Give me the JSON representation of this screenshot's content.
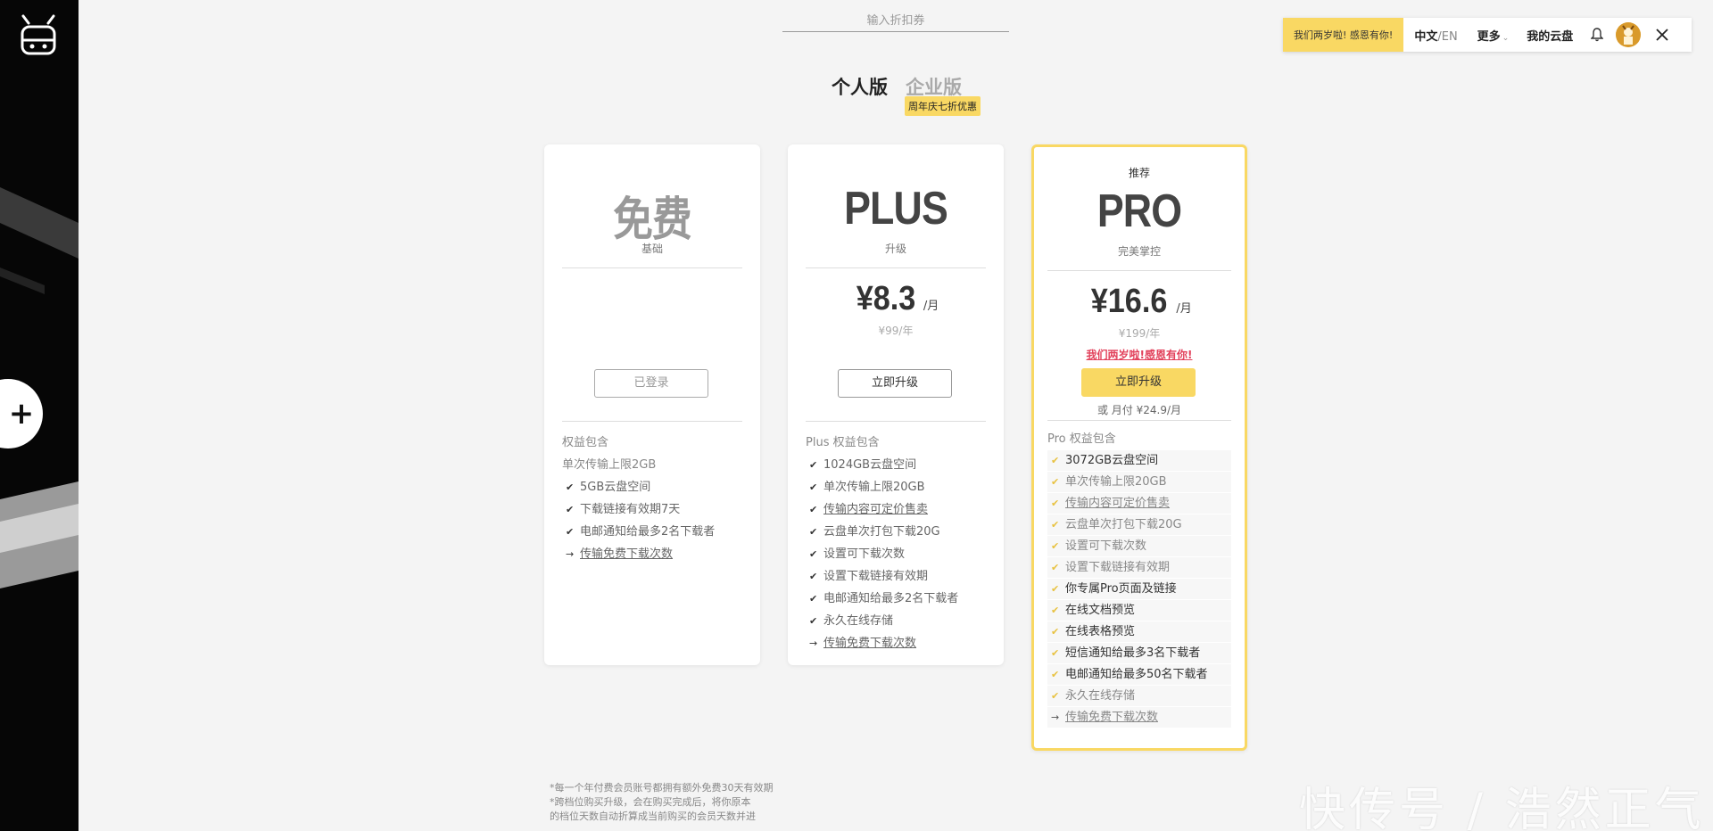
{
  "coupon": {
    "placeholder": "输入折扣券"
  },
  "topbar": {
    "promo": "我们两岁啦! 感恩有你!",
    "lang_cn": "中文",
    "lang_en": "/EN",
    "more": "更多",
    "mycloud": "我的云盘"
  },
  "tabs": {
    "personal": "个人版",
    "enterprise": "企业版",
    "badge": "周年庆七折优惠"
  },
  "plans": {
    "free": {
      "name": "免费",
      "sub": "基础",
      "button": "已登录",
      "features_head": "权益包含",
      "features_intro": "单次传输上限2GB",
      "features": [
        "5GB云盘空间",
        "下载链接有效期7天",
        "电邮通知给最多2名下载者"
      ],
      "link": "传输免费下载次数"
    },
    "plus": {
      "name": "PLUS",
      "sub": "升级",
      "price": "¥8.3",
      "unit": "/月",
      "yearly": "¥99/年",
      "button": "立即升级",
      "features_head": "Plus 权益包含",
      "features": [
        "1024GB云盘空间",
        "单次传输上限20GB",
        "传输内容可定价售卖",
        "云盘单次打包下载20G",
        "设置可下载次数",
        "设置下载链接有效期",
        "电邮通知给最多2名下载者",
        "永久在线存储"
      ],
      "link": "传输免费下载次数"
    },
    "pro": {
      "recommend": "推荐",
      "name": "PRO",
      "sub": "完美掌控",
      "price": "¥16.6",
      "unit": "/月",
      "yearly": "¥199/年",
      "promo": "我们两岁啦!感恩有你!",
      "button": "立即升级",
      "monthly": "或 月付 ¥24.9/月",
      "features_head": "Pro 权益包含",
      "features": [
        "3072GB云盘空间",
        "单次传输上限20GB",
        "传输内容可定价售卖",
        "云盘单次打包下载20G",
        "设置可下载次数",
        "设置下载链接有效期",
        "你专属Pro页面及链接",
        "在线文档预览",
        "在线表格预览",
        "短信通知给最多3名下载者",
        "电邮通知给最多50名下载者",
        "永久在线存储"
      ],
      "link": "传输免费下载次数"
    }
  },
  "footnote": {
    "line1": "*每一个年付费会员账号都拥有额外免费30天有效期",
    "line2": "*跨档位购买升级，会在购买完成后，将你原本",
    "line3": "的档位天数自动折算成当前购买的会员天数并进"
  },
  "watermark": "快传号 / 浩然正气",
  "colors": {
    "accent": "#f9d863",
    "promo_red": "#e2415b",
    "sidebar": "#050505"
  },
  "icons": [
    "logo-icon",
    "plus-icon",
    "bell-icon",
    "avatar",
    "close-icon",
    "check-icon",
    "arrow-right-icon"
  ]
}
